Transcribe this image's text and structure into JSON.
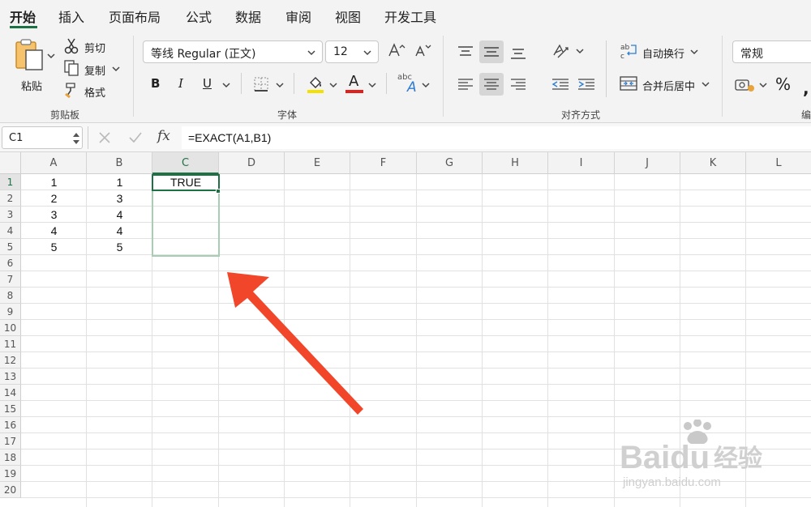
{
  "ribbon_tabs": [
    {
      "label": "开始",
      "active": true
    },
    {
      "label": "插入"
    },
    {
      "label": "页面布局"
    },
    {
      "label": "公式"
    },
    {
      "label": "数据"
    },
    {
      "label": "审阅"
    },
    {
      "label": "视图"
    },
    {
      "label": "开发工具"
    }
  ],
  "clipboard": {
    "paste_label": "粘贴",
    "cut_label": "剪切",
    "copy_label": "复制",
    "format_painter_label": "格式",
    "group_label": "剪贴板"
  },
  "font": {
    "family": "等线 Regular (正文)",
    "size": "12",
    "bold_label": "B",
    "italic_label": "I",
    "underline_label": "U",
    "font_color_glyph": "A",
    "phonetic_glyph": "abc",
    "group_label": "字体"
  },
  "alignment": {
    "wrap_text_label": "自动换行",
    "merge_center_label": "合并后居中",
    "group_label": "对齐方式"
  },
  "number": {
    "format": "常规",
    "percent_glyph": "%",
    "group_label_partial": "编"
  },
  "formula_bar": {
    "name_box": "C1",
    "fx_label": "fx",
    "formula": "=EXACT(A1,B1)"
  },
  "sheet": {
    "columns": [
      "A",
      "B",
      "C",
      "D",
      "E",
      "F",
      "G",
      "H",
      "I",
      "J",
      "K",
      "L"
    ],
    "rows": [
      "1",
      "2",
      "3",
      "4",
      "5",
      "6",
      "7",
      "8",
      "9",
      "10",
      "11",
      "12",
      "13",
      "14",
      "15",
      "16",
      "17",
      "18",
      "19",
      "20"
    ],
    "col_a": [
      "1",
      "2",
      "3",
      "4",
      "5"
    ],
    "col_b": [
      "1",
      "3",
      "4",
      "4",
      "5"
    ],
    "c1": "TRUE",
    "active_cell": "C1",
    "selected_range": "C1:C5"
  },
  "annotation": {
    "arrow_color": "#f2462b"
  },
  "watermark": {
    "brand": "Baidu",
    "brand_cn": "经验",
    "url": "jingyan.baidu.com"
  },
  "colors": {
    "accent": "#1e7145",
    "selection_outline": "#a7cdb3",
    "fill_yellow": "#f5e100",
    "font_red": "#e0201c"
  }
}
